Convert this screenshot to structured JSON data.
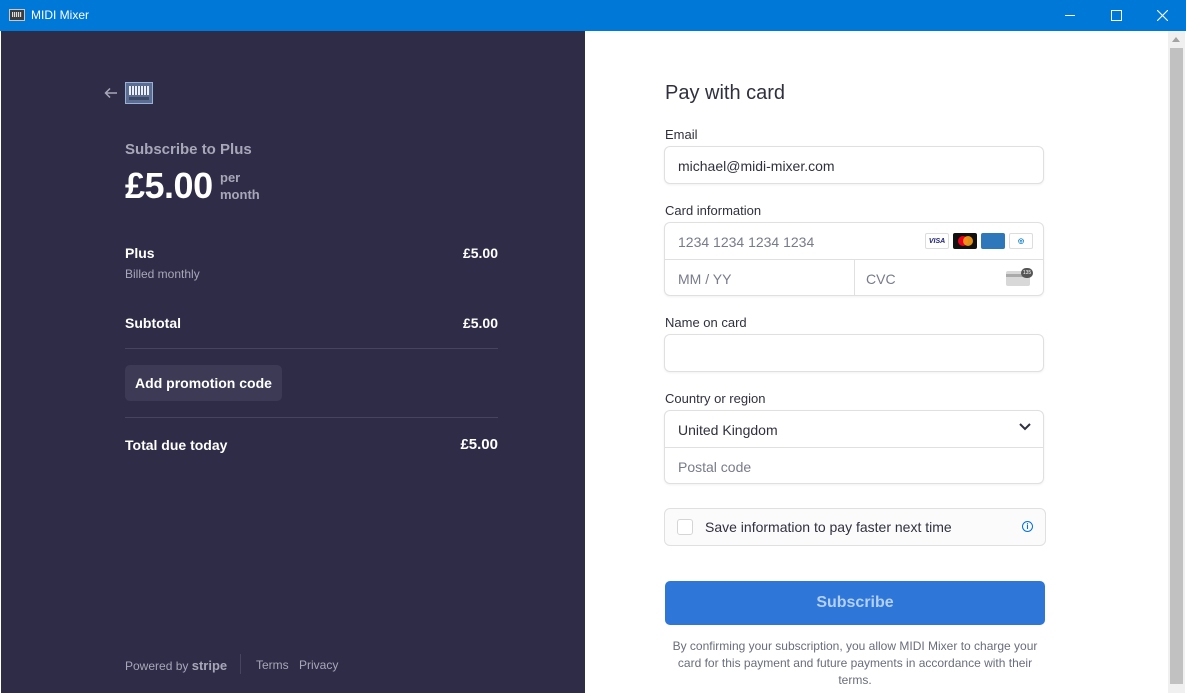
{
  "window": {
    "title": "MIDI Mixer"
  },
  "summary": {
    "subscribe_label": "Subscribe to Plus",
    "price": "£5.00",
    "period_line1": "per",
    "period_line2": "month",
    "line_item_name": "Plus",
    "line_item_amount": "£5.00",
    "line_item_sub": "Billed monthly",
    "subtotal_label": "Subtotal",
    "subtotal_amount": "£5.00",
    "promo_button": "Add promotion code",
    "total_label": "Total due today",
    "total_amount": "£5.00"
  },
  "footer": {
    "powered_by": "Powered by",
    "brand": "stripe",
    "terms": "Terms",
    "privacy": "Privacy"
  },
  "form": {
    "title": "Pay with card",
    "email_label": "Email",
    "email_value": "michael@midi-mixer.com",
    "card_label": "Card information",
    "card_number_placeholder": "1234 1234 1234 1234",
    "expiry_placeholder": "MM / YY",
    "cvc_placeholder": "CVC",
    "card_brands": [
      "VISA",
      "mastercard",
      "AMEX",
      "diners"
    ],
    "name_label": "Name on card",
    "name_value": "",
    "country_label": "Country or region",
    "country_value": "United Kingdom",
    "postal_placeholder": "Postal code",
    "save_info_text": "Save information to pay faster next time",
    "save_info_checked": false,
    "subscribe_button": "Subscribe",
    "legal_text": "By confirming your subscription, you allow MIDI Mixer to charge your card for this payment and future payments in accordance with their terms."
  },
  "colors": {
    "titlebar": "#0078d7",
    "left_panel": "#2e2c47",
    "subscribe_button": "#2e76d8"
  }
}
